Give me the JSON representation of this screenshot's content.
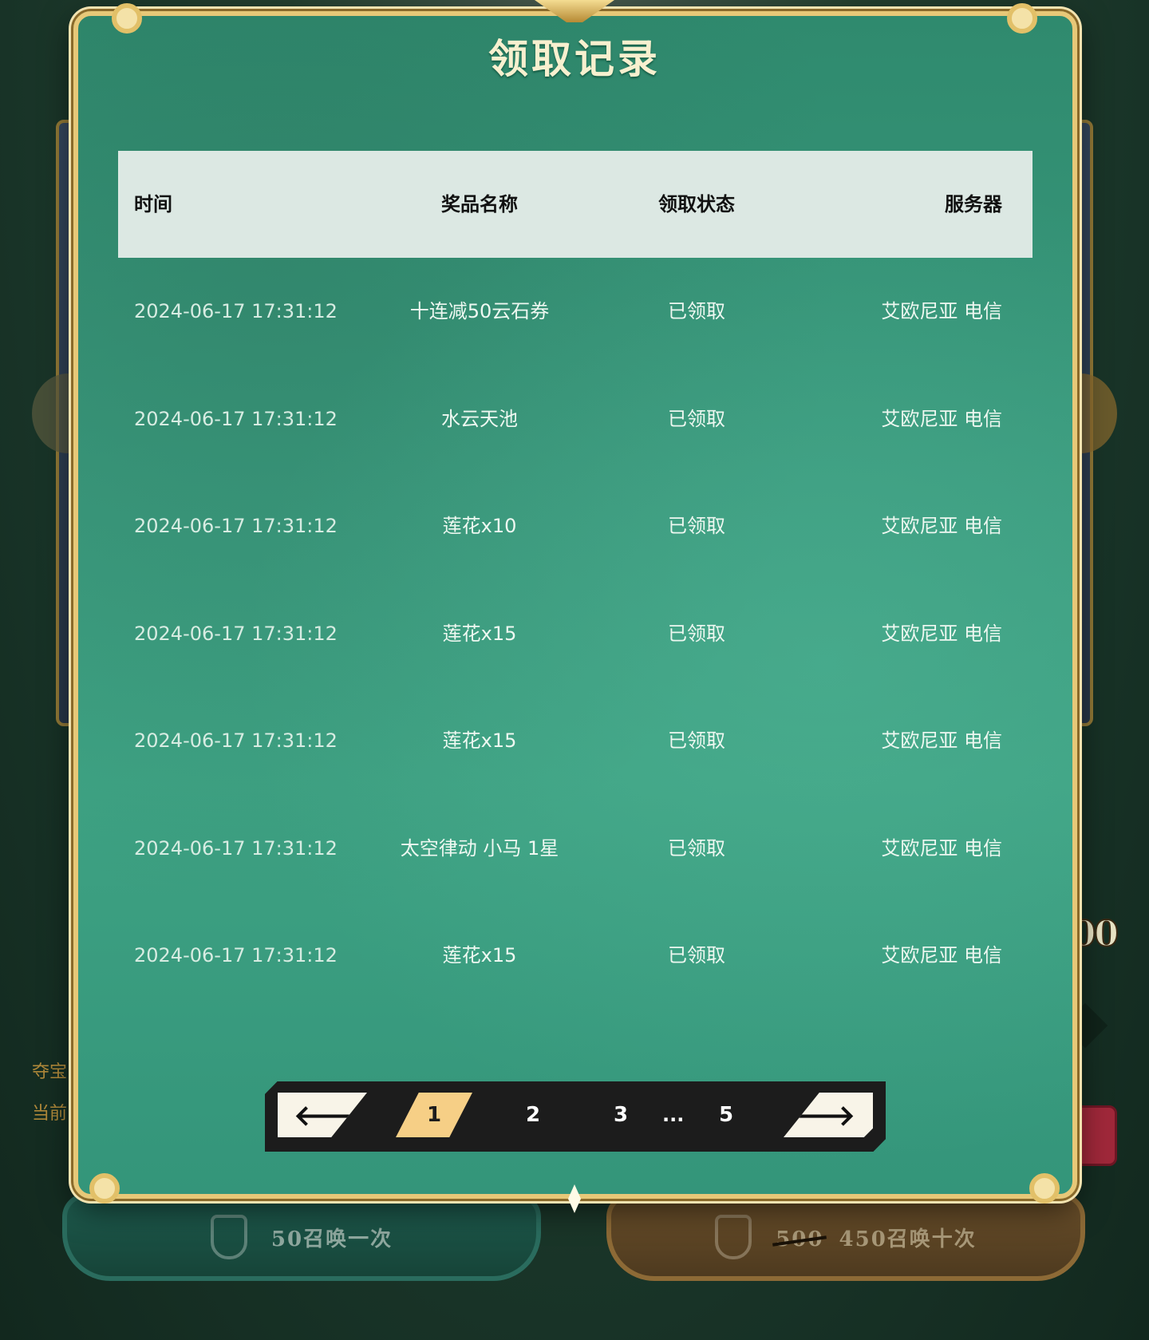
{
  "modal": {
    "title": "领取记录"
  },
  "table": {
    "headers": {
      "time": "时间",
      "prize": "奖品名称",
      "status": "领取状态",
      "server": "服务器"
    },
    "rows": [
      {
        "time": "2024-06-17 17:31:12",
        "prize": "十连减50云石券",
        "status": "已领取",
        "server": "艾欧尼亚 电信"
      },
      {
        "time": "2024-06-17 17:31:12",
        "prize": "水云天池",
        "status": "已领取",
        "server": "艾欧尼亚 电信"
      },
      {
        "time": "2024-06-17 17:31:12",
        "prize": "莲花x10",
        "status": "已领取",
        "server": "艾欧尼亚 电信"
      },
      {
        "time": "2024-06-17 17:31:12",
        "prize": "莲花x15",
        "status": "已领取",
        "server": "艾欧尼亚 电信"
      },
      {
        "time": "2024-06-17 17:31:12",
        "prize": "莲花x15",
        "status": "已领取",
        "server": "艾欧尼亚 电信"
      },
      {
        "time": "2024-06-17 17:31:12",
        "prize": "太空律动 小马 1星",
        "status": "已领取",
        "server": "艾欧尼亚 电信"
      },
      {
        "time": "2024-06-17 17:31:12",
        "prize": "莲花x15",
        "status": "已领取",
        "server": "艾欧尼亚 电信"
      }
    ]
  },
  "pagination": {
    "prev_icon": "arrow-left-icon",
    "next_icon": "arrow-right-icon",
    "prev_glyph": "🡐",
    "next_glyph": "🡒",
    "pages": [
      "1",
      "2",
      "3",
      "5"
    ],
    "ellipsis": "...",
    "current": "1"
  },
  "background": {
    "side_text_1": "夺宝",
    "side_text_2": "当前",
    "big_number": "00",
    "summon_one": {
      "cost": "50",
      "label": "召唤一次"
    },
    "summon_ten": {
      "old_cost": "500",
      "cost": "450",
      "label": "召唤十次"
    }
  },
  "colors": {
    "modal_bg": "#3a9a7d",
    "header_bg": "#dce8e3",
    "gold_border": "#e7c878",
    "active_page": "#f6cf86",
    "pager_bg": "#1c1c1c"
  }
}
